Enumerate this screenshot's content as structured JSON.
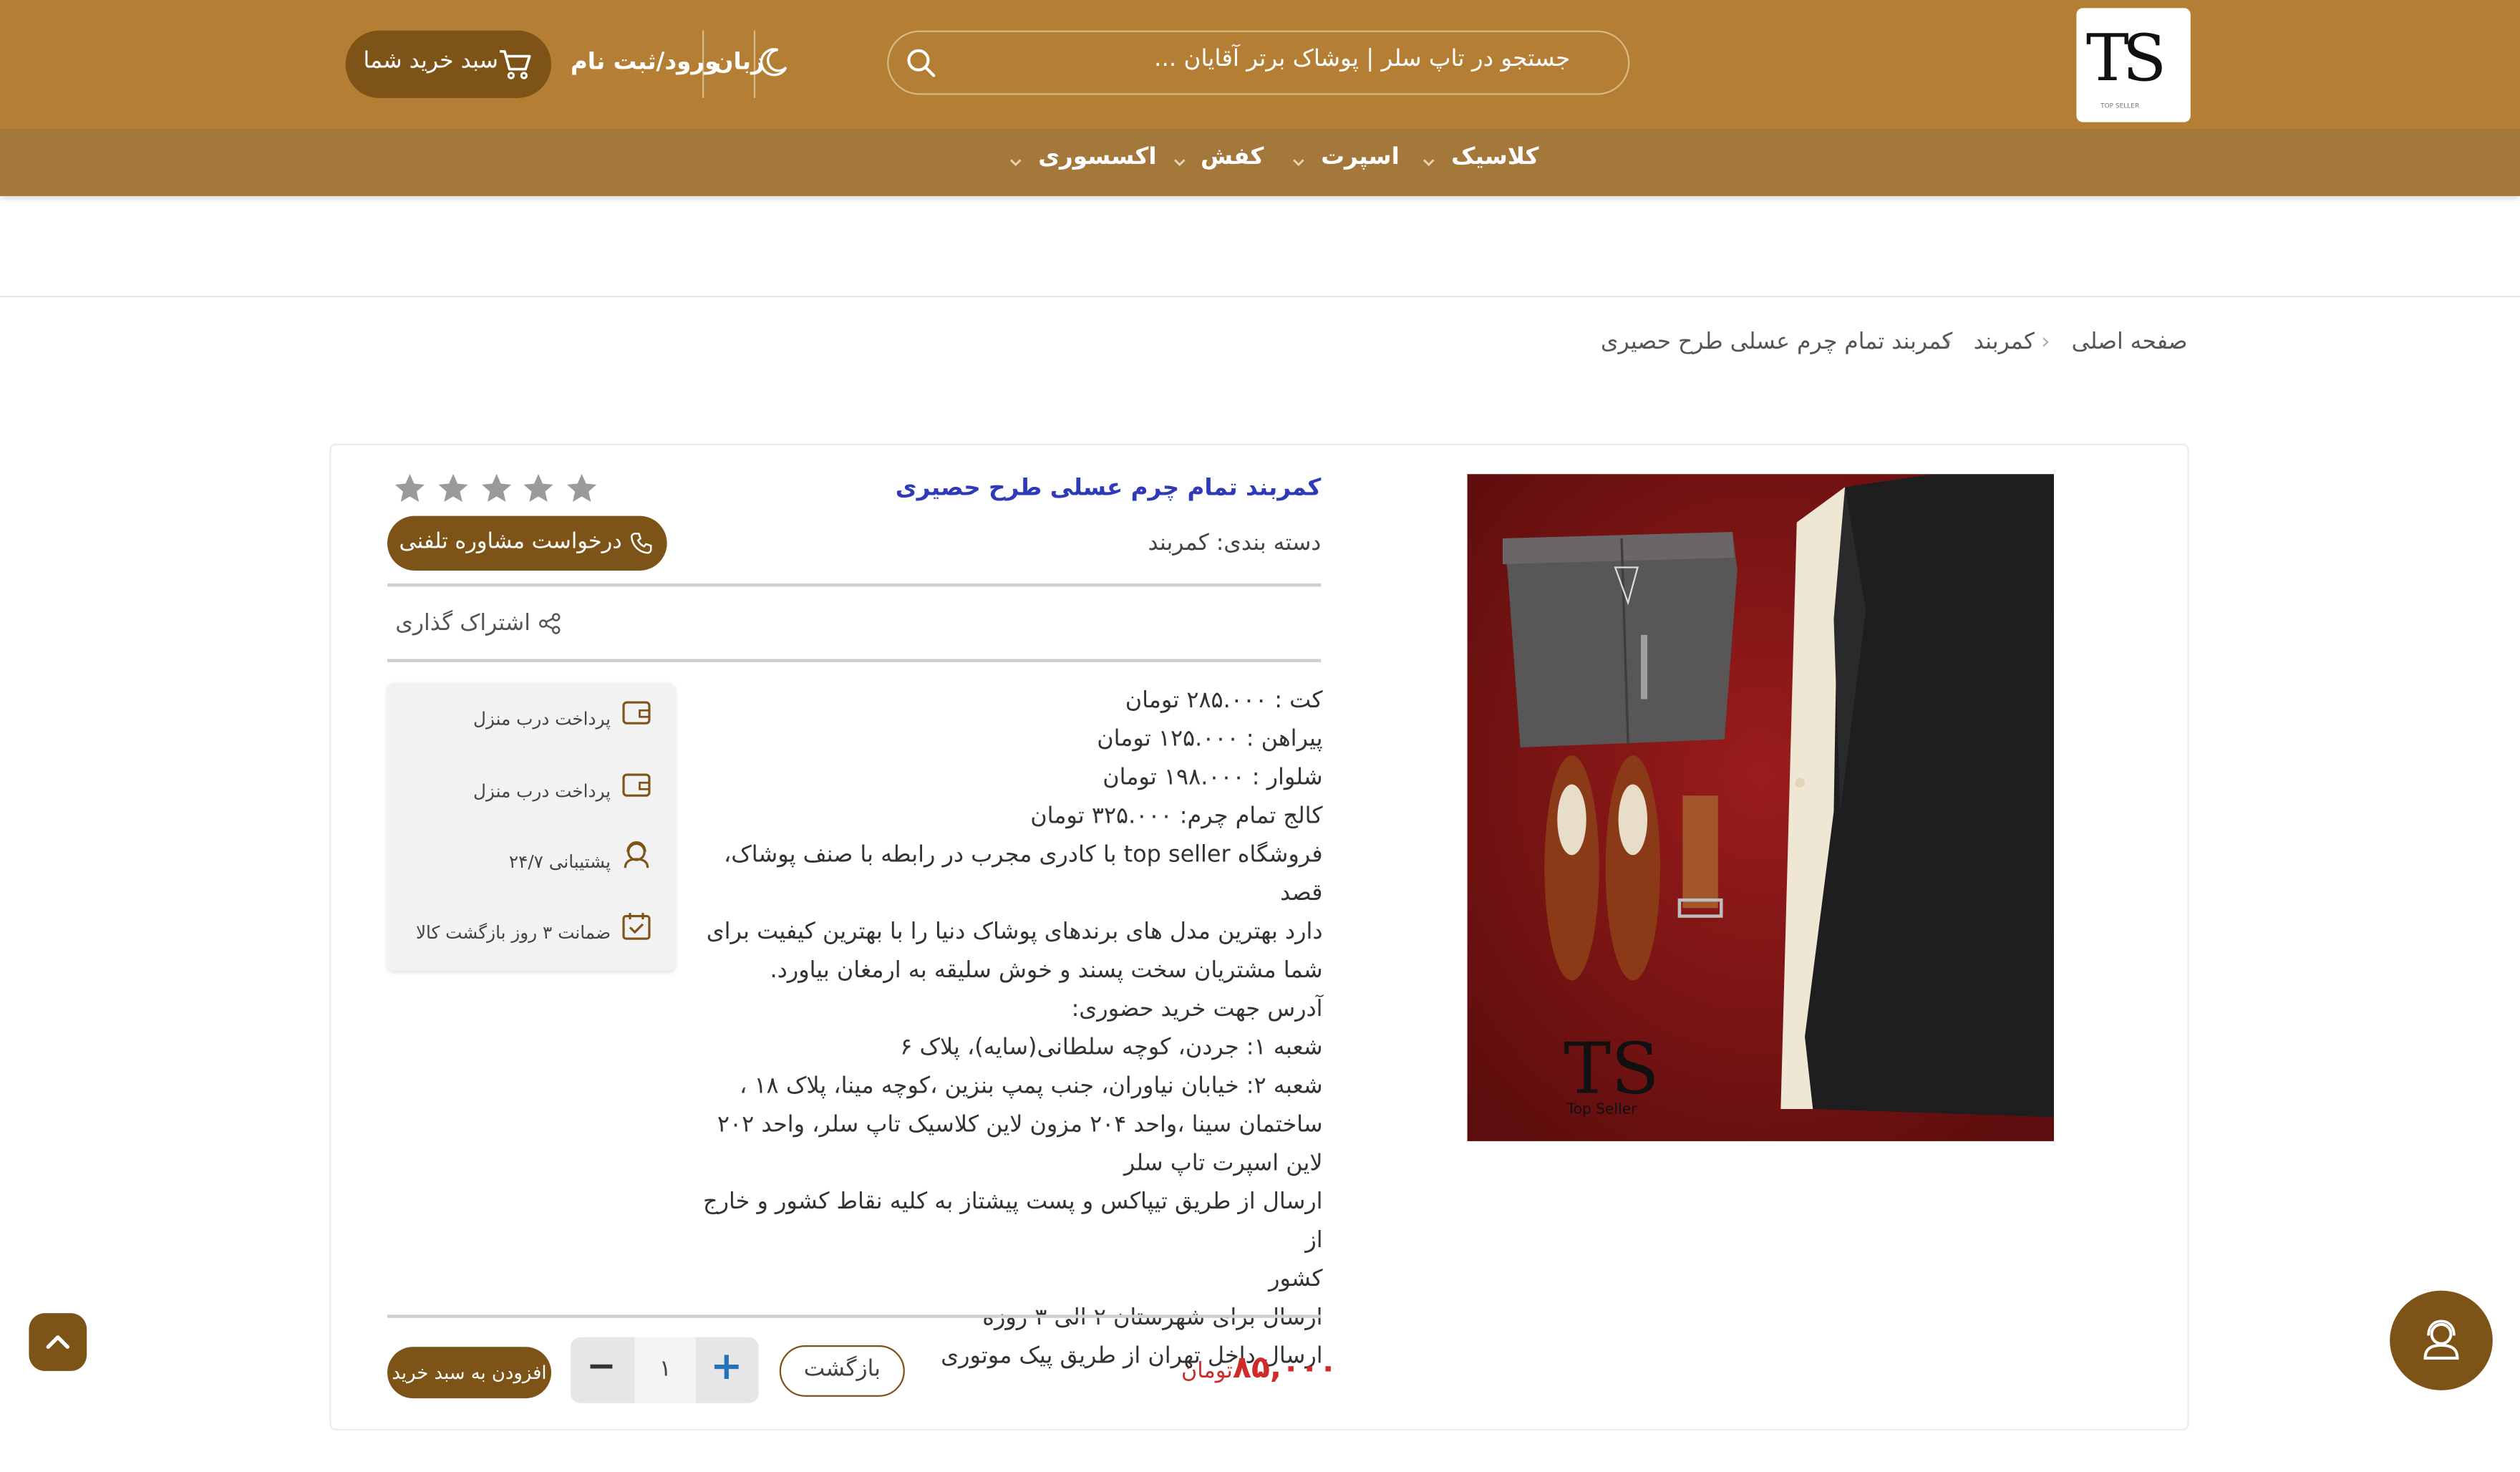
{
  "header": {
    "logo_text": "TS",
    "logo_tagline": "TOP SELLER",
    "search_placeholder": "جستجو در تاپ سلر | پوشاک برتر آقایان ...",
    "language_label": "زبان",
    "login_label": "ورود/ثبت نام",
    "cart_label": "سبد خرید شما",
    "colors": {
      "top_bar": "#b47f35",
      "nav_bar": "#a4773b",
      "accent": "#7d5317"
    }
  },
  "nav": {
    "items": [
      {
        "label": "کلاسیک"
      },
      {
        "label": "اسپرت"
      },
      {
        "label": "کفش"
      },
      {
        "label": "اکسسوری"
      }
    ]
  },
  "breadcrumb": {
    "items": [
      "صفحه اصلی",
      "کمربند",
      "کمربند تمام چرم عسلی طرح حصیری"
    ]
  },
  "product": {
    "title": "کمربند تمام چرم عسلی طرح حصیری",
    "category": "دسته بندی: کمربند",
    "rating": 0,
    "rating_max": 5,
    "consult_button": "درخواست مشاوره تلفنی",
    "share_label": "اشتراک گذاری",
    "description_lines": [
      "کت : ۲۸۵.۰۰۰ تومان",
      "پیراهن : ۱۲۵.۰۰۰ تومان",
      "شلوار : ۱۹۸.۰۰۰ تومان",
      "کالج تمام چرم: ۳۲۵.۰۰۰ تومان",
      "فروشگاه top seller با کادری مجرب در رابطه با صنف پوشاک، قصد",
      "دارد بهترین مدل های برندهای پوشاک دنیا را با بهترین کیفیت برای",
      "شما مشتریان سخت پسند و خوش سلیقه به ارمغان بیاورد.",
      "آدرس جهت خرید حضوری:",
      "شعبه ۱: جردن، کوچه سلطانی(سایه)، پلاک ۶",
      "شعبه ۲: خیابان نیاوران، جنب پمپ بنزین ،کوچه مینا، پلاک ۱۸ ،",
      "ساختمان سینا ،واحد ۲۰۴ مزون لاین کلاسیک تاپ سلر، واحد ۲۰۲",
      "لاین اسپرت تاپ سلر",
      "ارسال از طریق تیپاکس و پست پیشتاز به کلیه نقاط کشور و خارج از",
      "کشور",
      "ارسال برای شهرستان ۲ الی ۳ روزه",
      "ارسال داخل تهران از طریق پیک موتوری"
    ],
    "features": [
      {
        "icon": "wallet-icon",
        "label": "پرداخت درب منزل"
      },
      {
        "icon": "wallet-icon",
        "label": "پرداخت درب منزل"
      },
      {
        "icon": "support-agent-icon",
        "label": "پشتیبانی ۲۴/۷"
      },
      {
        "icon": "calendar-check-icon",
        "label": "ضمانت ۳ روز بازگشت کالا"
      }
    ],
    "price_value": "۸۵,۰۰۰",
    "price_unit": "تومان",
    "back_button": "بازگشت",
    "quantity": "۱",
    "add_to_cart_button": "افزودن به سبد خرید",
    "image_caption": "Top Seller"
  }
}
